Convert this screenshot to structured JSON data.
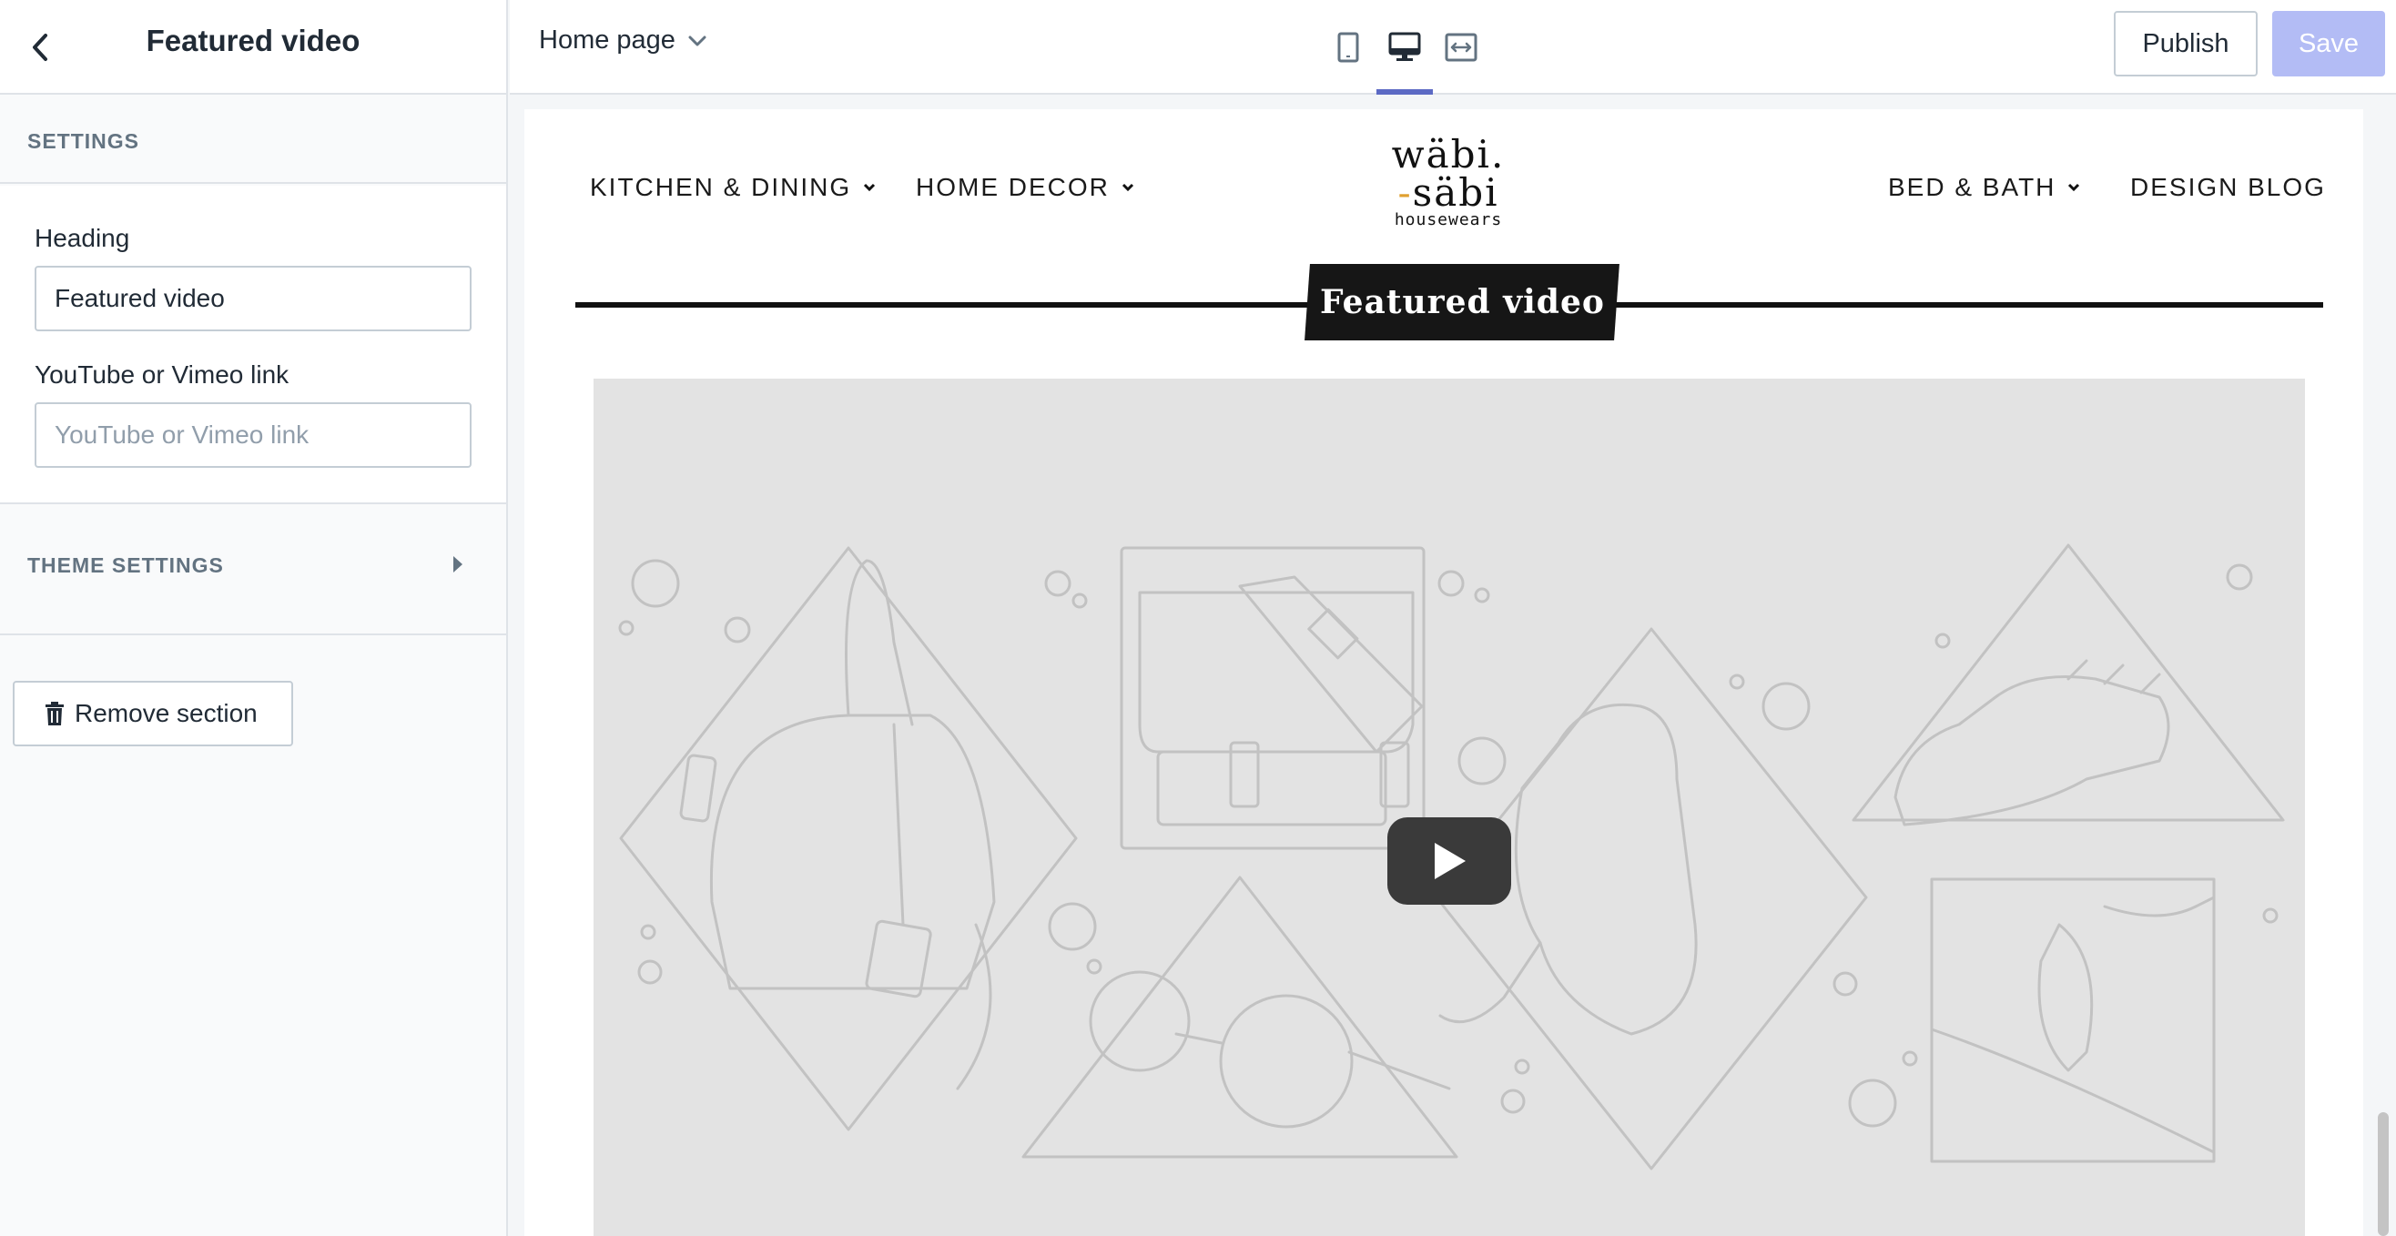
{
  "sidebar": {
    "title": "Featured video",
    "settings_label": "SETTINGS",
    "fields": [
      {
        "label": "Heading",
        "value": "Featured video",
        "placeholder": ""
      },
      {
        "label": "YouTube or Vimeo link",
        "value": "",
        "placeholder": "YouTube or Vimeo link"
      }
    ],
    "theme_settings_label": "THEME SETTINGS",
    "remove_label": "Remove section"
  },
  "topbar": {
    "page_select": "Home page",
    "devices": [
      {
        "name": "mobile",
        "icon": "mobile-icon",
        "active": false
      },
      {
        "name": "desktop",
        "icon": "desktop-icon",
        "active": true
      },
      {
        "name": "full-width",
        "icon": "full-width-icon",
        "active": false
      }
    ],
    "publish_label": "Publish",
    "save_label": "Save"
  },
  "store": {
    "nav_left": [
      {
        "label": "KITCHEN & DINING",
        "dropdown": true
      },
      {
        "label": "HOME DECOR",
        "dropdown": true
      }
    ],
    "nav_right": [
      {
        "label": "BED & BATH",
        "dropdown": true
      },
      {
        "label": "DESIGN BLOG",
        "dropdown": false
      }
    ],
    "logo": {
      "line1": "wäbi.",
      "line2_dash": "-",
      "line2": "säbi",
      "line3": "housewears"
    },
    "section_heading": "Featured video",
    "video": {
      "play_icon": "play-icon"
    }
  },
  "colors": {
    "accent": "#5c6ac4",
    "save_disabled": "#b3bcf5",
    "border": "#dfe3e8",
    "video_bg": "#e3e3e3",
    "logo_accent": "#e0a030"
  }
}
